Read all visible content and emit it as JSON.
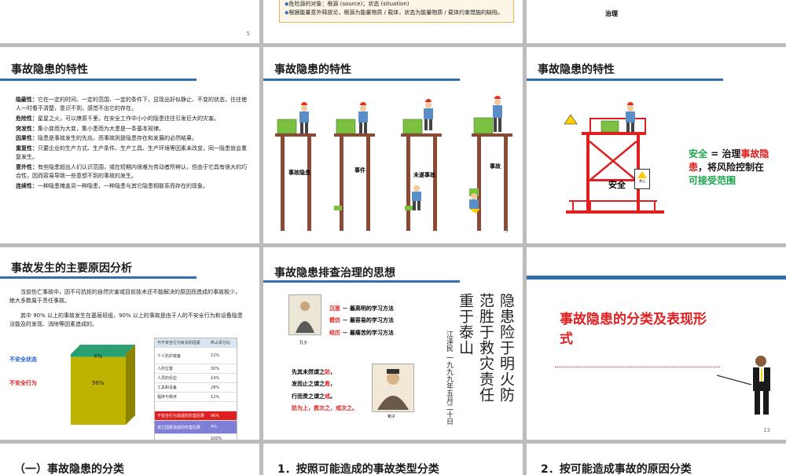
{
  "slides": {
    "top_left": {
      "page": "5"
    },
    "top_mid": {
      "bullets": [
        "危险源的对象：根源 (source)；状态 (situation)",
        "根据能量意外释放论，根源为能量物质 / 载体，状态为能量物质 / 载体约束措施的缺陷。"
      ]
    },
    "top_right": {
      "caption": "治理"
    },
    "feature_text": {
      "title": "事故隐患的特性",
      "items": [
        {
          "label": "隐蔽性：",
          "text": "它在一定的时间、一定的范围、一定的条件下，显现出好似静止、不变的状态，往往使人一时看不清楚，意识不到，感觉不出它的存在。"
        },
        {
          "label": "危险性：",
          "text": "星星之火，可以燎原千里，在安全工作中小小的隐患往往引发巨大的灾害。"
        },
        {
          "label": "突发性：",
          "text": "集小变而为大变，集小患而为大患是一条基本规律。"
        },
        {
          "label": "因果性：",
          "text": "隐患是事故发生的先兆，而事故则是隐患存在和发展的必然结果。"
        },
        {
          "label": "重复性：",
          "text": "只要企业的生产方式、生产条件、生产工具、生产环境等因素未改变，同一隐患就会重复发生。"
        },
        {
          "label": "意外性：",
          "text": "有些隐患超出人们认识范围，或在短期内很难为劳动者所辨认，但由于它具有很大的巧合性，因而容易导致一些意想不到的事故的发生。"
        },
        {
          "label": "连续性：",
          "text": "一种隐患掩盖另一种隐患，一种隐患与其它隐患相联系而存在的现象。"
        }
      ]
    },
    "feature_pic": {
      "title": "事故隐患的特性",
      "labels": [
        "事故隐患",
        "事件",
        "未遂事故",
        "事故"
      ],
      "page": "9"
    },
    "feature_safety": {
      "title": "事故隐患的特性",
      "safe_label": "安全",
      "statement_parts": [
        {
          "text": "安全 ",
          "color": "#1aa64a"
        },
        {
          "text": "= 治理",
          "color": "#1a1a1a"
        },
        {
          "text": "事故隐患",
          "color": "#e02020"
        },
        {
          "text": "，将风险控制在",
          "color": "#1a1a1a"
        },
        {
          "text": "可接受范围",
          "color": "#1aa64a"
        }
      ],
      "sign_text": "安全",
      "sign_text2": "禁止"
    },
    "causes": {
      "title": "事故发生的主要原因分析",
      "para1": "当前伤亡事故中，因不可抗拒的自然灾害或目前技术还不能解决的原因而造成的事故极少，绝大多数属于责任事故。",
      "para2": "其中 90% 以上的事故发生在基层班组，90% 以上的事故是由于人的不安全行为和设备隐患没能及时发现、消除等因素造成的。",
      "chart_data": {
        "type": "bar",
        "categories": [
          "不安全状态",
          "不安全行为"
        ],
        "values": [
          4,
          96
        ],
        "unit": "%"
      },
      "table": {
        "header": [
          "与不安全行为有关的因素",
          "所占百分比"
        ],
        "rows": [
          [
            "个人防护装备",
            "12%"
          ],
          [
            "人的位置",
            "30%"
          ],
          [
            "人员的反应",
            "14%"
          ],
          [
            "工具和设备",
            "28%"
          ],
          [
            "程序与秩序",
            "12%"
          ],
          [
            "",
            ""
          ],
          [
            "不安全行为造成的伤害后果",
            "96%"
          ],
          [
            "其它因素造成的伤害后果",
            "4%"
          ],
          [
            "",
            "100%"
          ]
        ]
      }
    },
    "thinking": {
      "title": "事故隐患排查治理的思想",
      "lines": [
        {
          "hl": "沉思",
          "rest": " － 最高明的学习方法"
        },
        {
          "hl": "模仿",
          "rest": " － 最容易的学习方法"
        },
        {
          "hl": "经历",
          "rest": " － 最痛苦的学习方法"
        }
      ],
      "confucius": "孔子",
      "sayings": [
        {
          "pre": "先其未然谓之",
          "hl": "防",
          "post": "，"
        },
        {
          "pre": "发而止之谓之",
          "hl": "救",
          "post": "，"
        },
        {
          "pre": "行而责之谓之",
          "hl": "戒",
          "post": "。"
        }
      ],
      "conclusion": "防为上，救次之，戒次之。",
      "author2": "荀子",
      "calligraphy_cols": [
        "隐患险于明火防",
        "范胜于救灾责任",
        "重于泰山",
        "江泽民 一九九九年五月二十日"
      ]
    },
    "classify": {
      "title": "事故隐患的分类及表现形式",
      "page": "13"
    },
    "bottom": [
      {
        "title": "（一）事故隐患的分类"
      },
      {
        "title": "1．按照可能造成的事故类型分类"
      },
      {
        "title": "2．按可能造成事故的原因分类"
      }
    ]
  },
  "colors": {
    "accent_blue": "#2f6fb0",
    "red": "#e02020",
    "green": "#1aa64a",
    "olive": "#bfb300"
  }
}
